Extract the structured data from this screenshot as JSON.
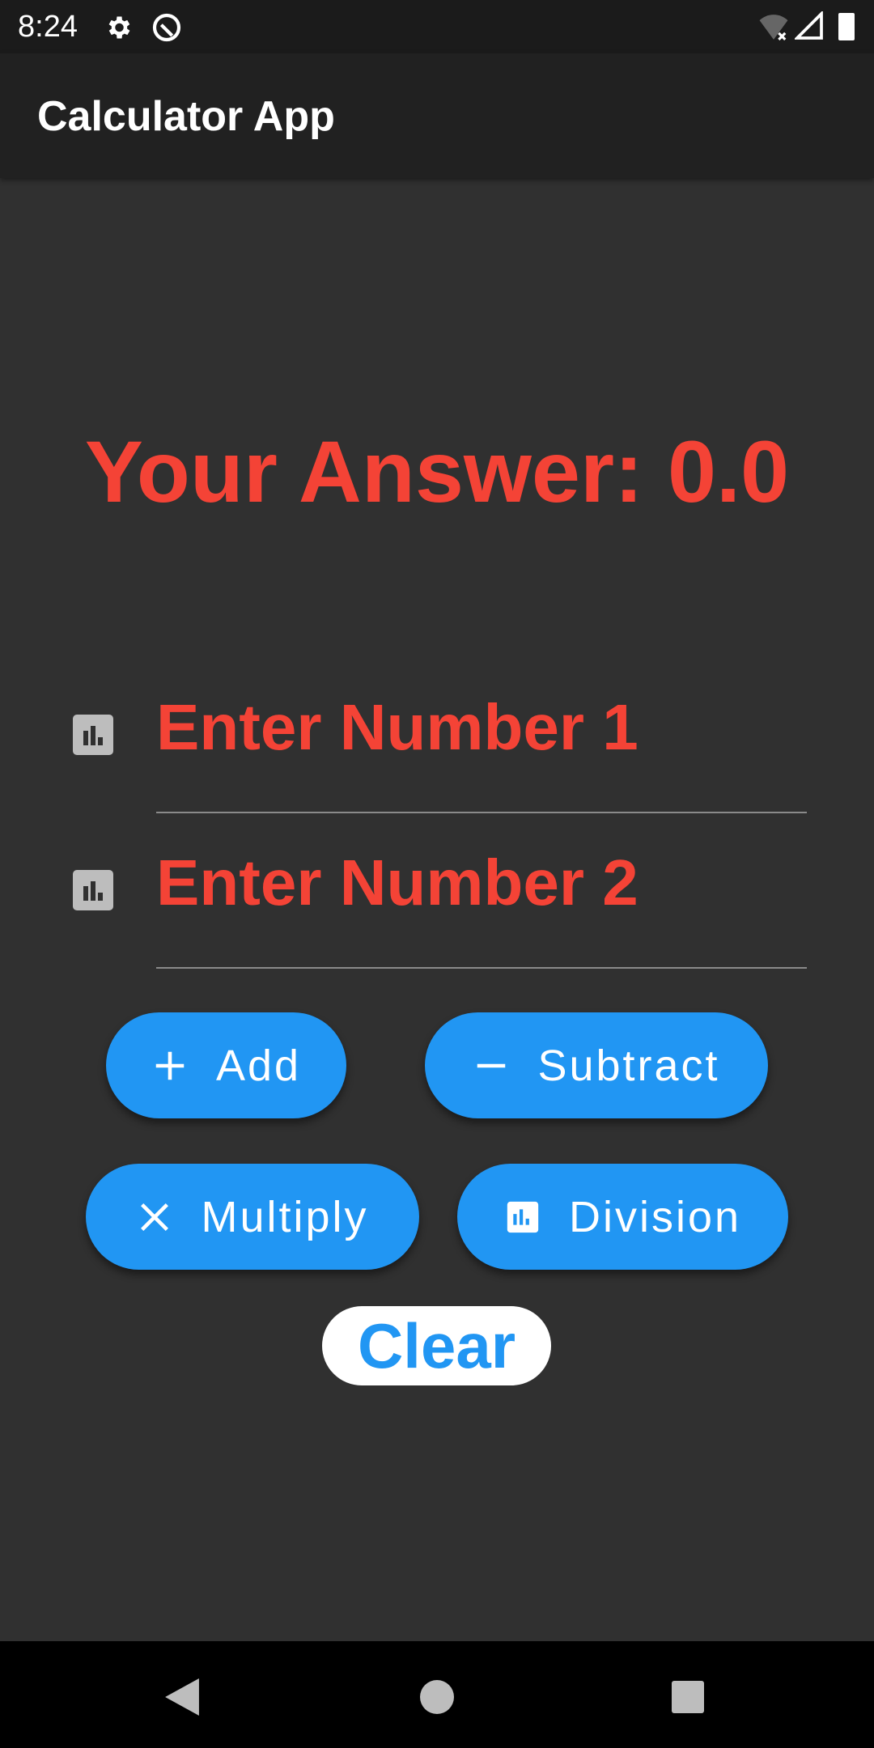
{
  "status_bar": {
    "time": "8:24",
    "icons": [
      "gear-icon",
      "data-saver-icon",
      "wifi-off-icon",
      "signal-icon",
      "battery-icon"
    ]
  },
  "app_bar": {
    "title": "Calculator App"
  },
  "answer": {
    "text": "Your Answer: 0.0"
  },
  "inputs": [
    {
      "placeholder": "Enter Number 1",
      "value": ""
    },
    {
      "placeholder": "Enter Number 2",
      "value": ""
    }
  ],
  "buttons": {
    "add": "Add",
    "subtract": "Subtract",
    "multiply": "Multiply",
    "division": "Division",
    "clear": "Clear"
  },
  "colors": {
    "accent": "#2196F3",
    "answer": "#F44336",
    "background": "#303030",
    "appbar": "#212121"
  }
}
